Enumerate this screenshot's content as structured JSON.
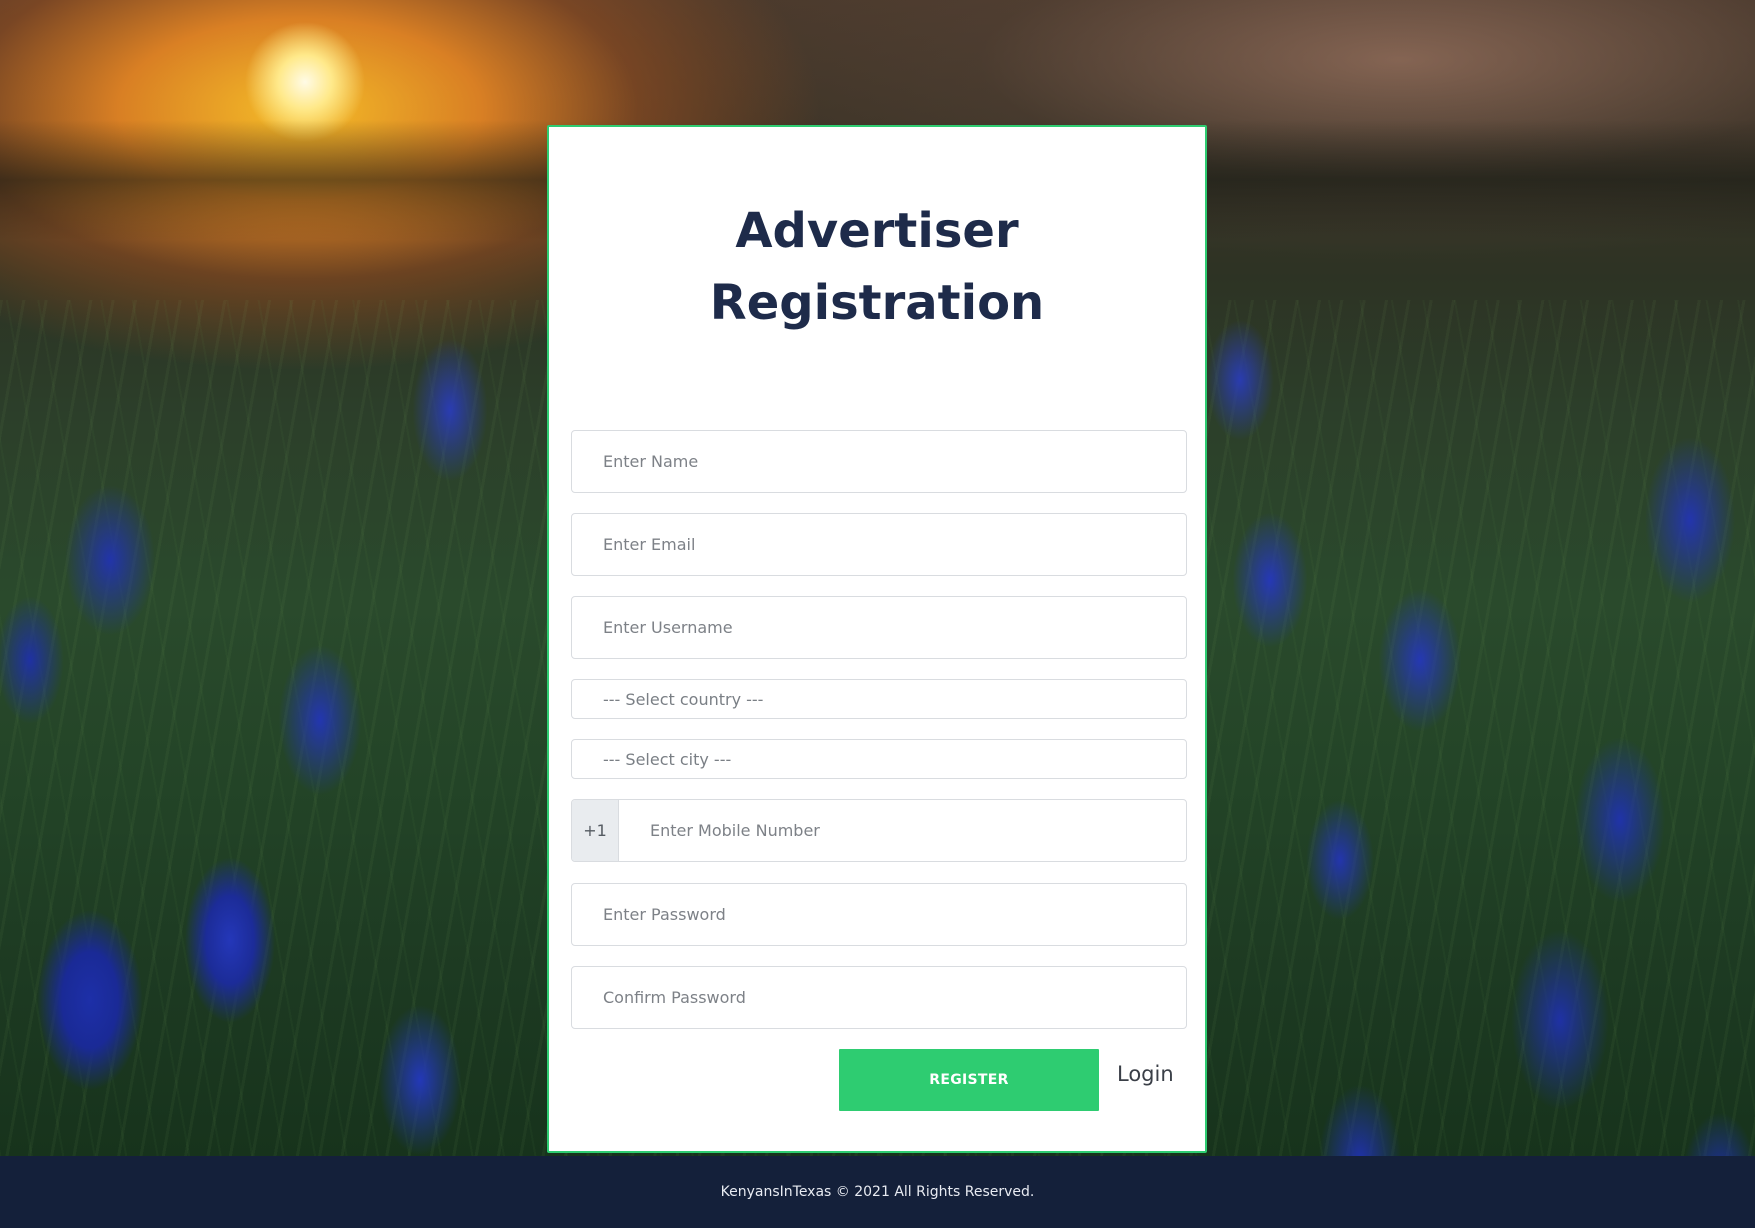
{
  "form": {
    "title_line1": "Advertiser",
    "title_line2": "Registration",
    "name_placeholder": "Enter Name",
    "email_placeholder": "Enter Email",
    "username_placeholder": "Enter Username",
    "country_select": "--- Select country ---",
    "city_select": "--- Select city ---",
    "phone_prefix": "+1",
    "mobile_placeholder": "Enter Mobile Number",
    "password_placeholder": "Enter Password",
    "confirm_password_placeholder": "Confirm Password",
    "register_label": "REGISTER",
    "login_label": "Login"
  },
  "footer": {
    "text": "KenyansInTexas © 2021 All Rights Reserved."
  },
  "colors": {
    "accent": "#2ecc71",
    "title": "#1e2b4a",
    "footer_bg": "#14203a"
  }
}
